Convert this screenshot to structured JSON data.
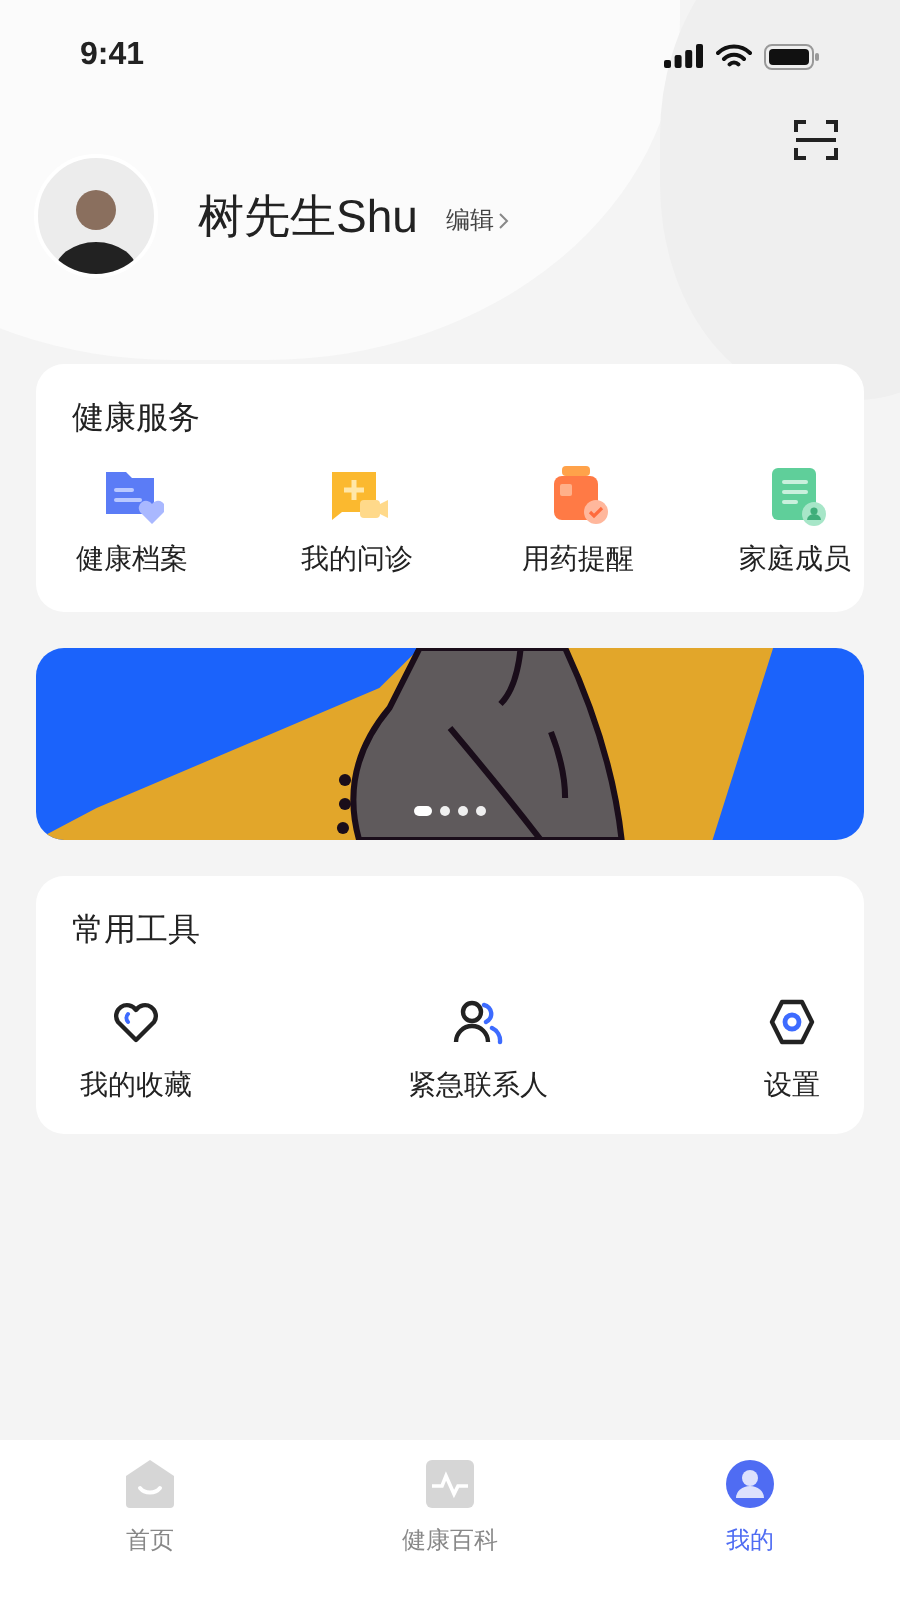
{
  "status_bar": {
    "time": "9:41"
  },
  "profile": {
    "name": "树先生Shu",
    "edit_label": "编辑"
  },
  "health_services": {
    "title": "健康服务",
    "items": [
      {
        "label": "健康档案",
        "kind": "records"
      },
      {
        "label": "我的问诊",
        "kind": "consult"
      },
      {
        "label": "用药提醒",
        "kind": "medicine"
      },
      {
        "label": "家庭成员",
        "kind": "family"
      }
    ]
  },
  "banner": {
    "pages": [
      {
        "selected": true
      },
      {
        "selected": false
      },
      {
        "selected": false
      },
      {
        "selected": false
      }
    ]
  },
  "tools": {
    "title": "常用工具",
    "items": [
      {
        "label": "我的收藏",
        "kind": "favorite"
      },
      {
        "label": "紧急联系人",
        "kind": "contacts"
      },
      {
        "label": "设置",
        "kind": "settings"
      }
    ]
  },
  "tab_bar": [
    {
      "label": "首页",
      "kind": "home",
      "selected": false
    },
    {
      "label": "健康百科",
      "kind": "wiki",
      "selected": false
    },
    {
      "label": "我的",
      "kind": "mine",
      "selected": true
    }
  ]
}
